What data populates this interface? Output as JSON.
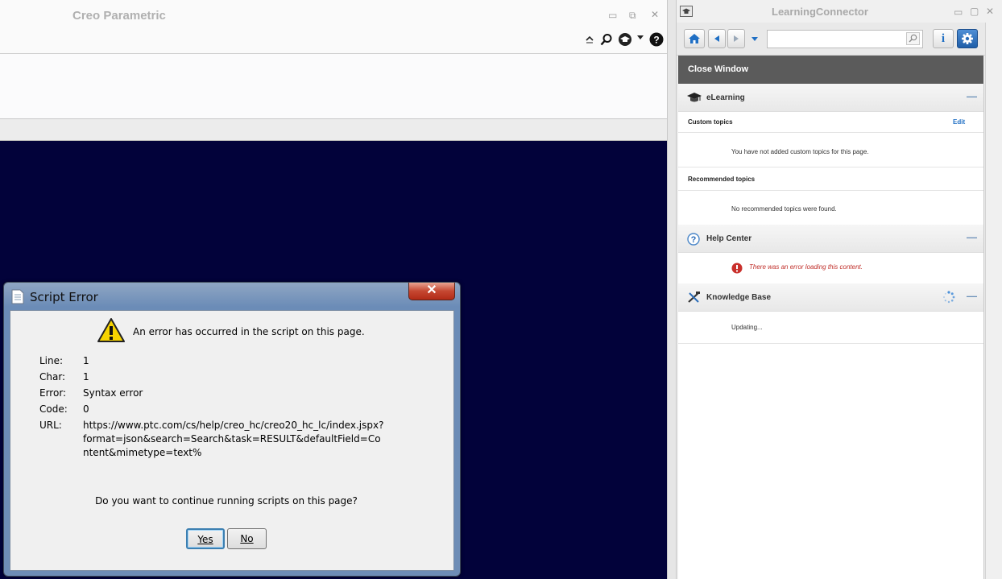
{
  "creo": {
    "title": "Creo Parametric",
    "window_buttons": {
      "minimize": "▭",
      "restore": "⧉",
      "close": "✕"
    }
  },
  "learning_connector": {
    "title": "LearningConnector",
    "window_buttons": {
      "minimize": "▭",
      "restore": "▢",
      "close": "✕"
    },
    "search": {
      "value": "",
      "placeholder": ""
    },
    "close_window": "Close Window",
    "sections": {
      "elearning": {
        "title": "eLearning",
        "custom_topics": "Custom topics",
        "edit": "Edit",
        "custom_msg": "You have not added custom topics for this page.",
        "recommended_topics": "Recommended topics",
        "recommended_msg": "No recommended topics were found."
      },
      "help_center": {
        "title": "Help Center",
        "error_msg": "There was an error loading this content."
      },
      "knowledge_base": {
        "title": "Knowledge Base",
        "status": "Updating..."
      }
    },
    "collapse_symbol": "—"
  },
  "dialog": {
    "title": "Script Error",
    "close_symbol": "✕",
    "message": "An error has occurred in the script on this page.",
    "fields": {
      "line_label": "Line:",
      "line": "1",
      "char_label": "Char:",
      "char": "1",
      "error_label": "Error:",
      "error": "Syntax error",
      "code_label": "Code:",
      "code": "0",
      "url_label": "URL:",
      "url_line1": "https://www.ptc.com/cs/help/creo_hc/creo20_hc_lc/index.jspx?",
      "url_line2": "format=json&search=Search&task=RESULT&defaultField=Co",
      "url_line3": "ntent&mimetype=text%"
    },
    "question": "Do you want to continue running scripts on this page?",
    "yes_label": "Yes",
    "no_label": "No"
  }
}
